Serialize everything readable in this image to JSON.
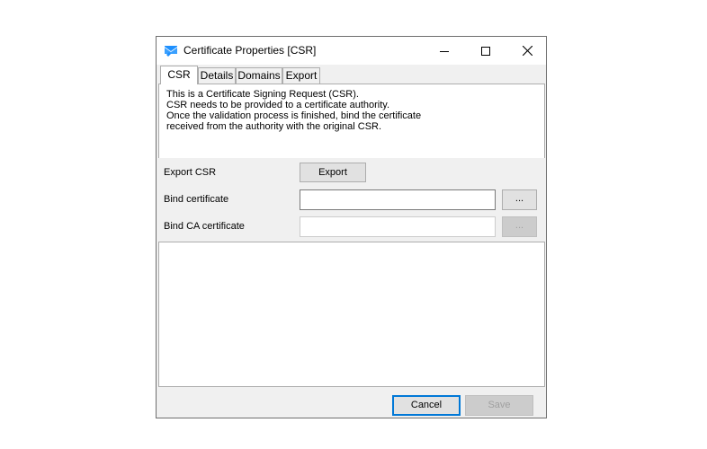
{
  "window": {
    "title": "Certificate Properties [CSR]",
    "controls": {
      "minimize": "minimize",
      "maximize": "maximize",
      "close": "close"
    }
  },
  "tabs": [
    {
      "label": "CSR",
      "active": true
    },
    {
      "label": "Details",
      "active": false
    },
    {
      "label": "Domains",
      "active": false
    },
    {
      "label": "Export",
      "active": false
    }
  ],
  "description": {
    "lines": [
      "This is a Certificate Signing Request (CSR).",
      "CSR needs to be provided to a certificate authority.",
      "Once the validation process is finished, bind the certificate",
      "received from the authority with the original CSR."
    ]
  },
  "form": {
    "export_csr": {
      "label": "Export CSR",
      "button": "Export"
    },
    "bind_certificate": {
      "label": "Bind certificate",
      "value": "",
      "browse": "..."
    },
    "bind_ca_certificate": {
      "label": "Bind CA certificate",
      "value": "",
      "browse": "...",
      "disabled": true
    }
  },
  "footer": {
    "cancel": "Cancel",
    "save": "Save",
    "save_disabled": true
  },
  "annotation": {
    "arrow_color": "#f03a24"
  },
  "colors": {
    "accent": "#0078d7",
    "icon": "#1e90ff"
  }
}
